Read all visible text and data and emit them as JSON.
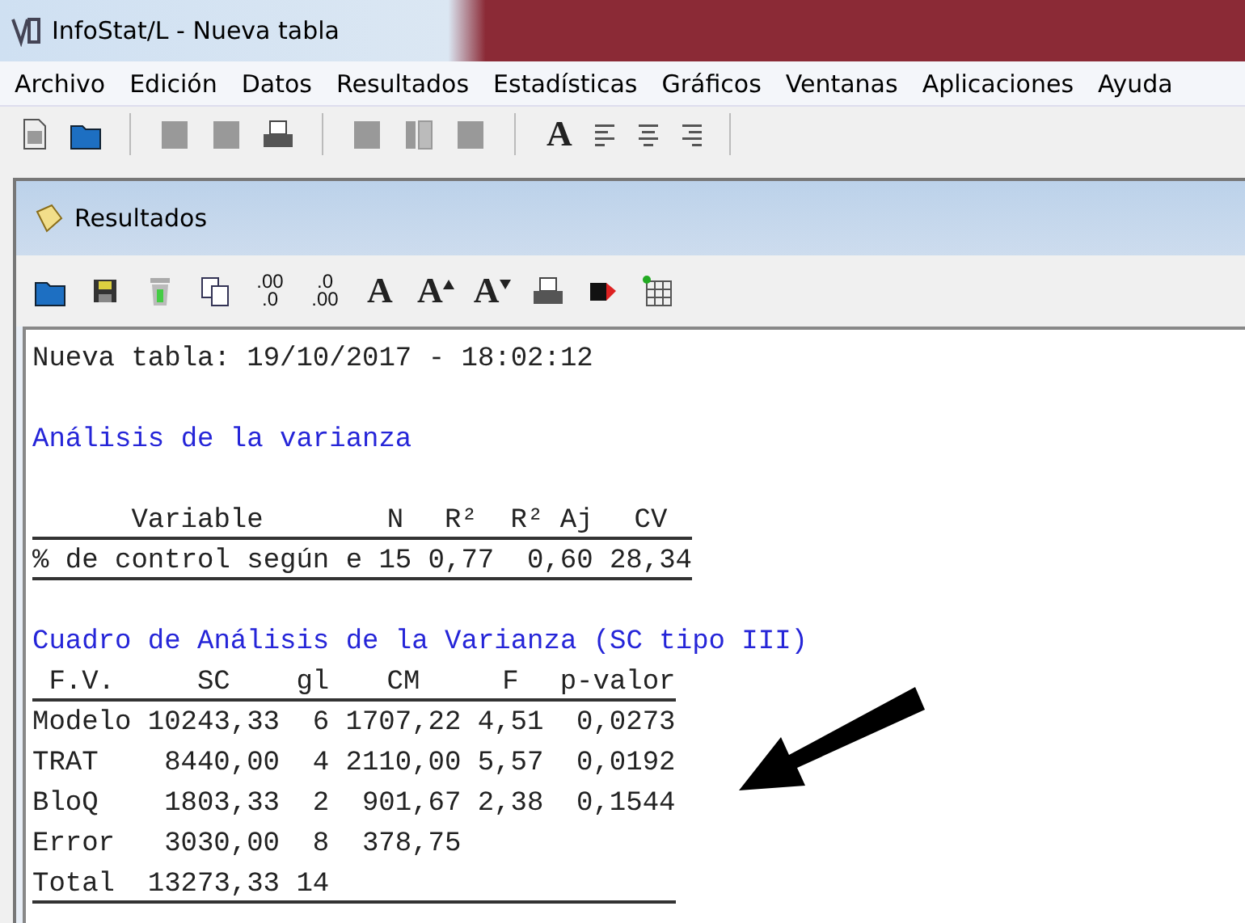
{
  "window": {
    "title": "InfoStat/L - Nueva tabla"
  },
  "menu": [
    "Archivo",
    "Edición",
    "Datos",
    "Resultados",
    "Estadísticas",
    "Gráficos",
    "Ventanas",
    "Aplicaciones",
    "Ayuda"
  ],
  "toolbar": [
    {
      "kind": "new"
    },
    {
      "kind": "open"
    },
    {
      "kind": "sep"
    },
    {
      "kind": "block"
    },
    {
      "kind": "block"
    },
    {
      "kind": "print"
    },
    {
      "kind": "sep"
    },
    {
      "kind": "block"
    },
    {
      "kind": "columns"
    },
    {
      "kind": "block"
    },
    {
      "kind": "sep"
    },
    {
      "kind": "letter",
      "text": "A"
    },
    {
      "kind": "align-left"
    },
    {
      "kind": "align-center"
    },
    {
      "kind": "align-right"
    },
    {
      "kind": "sep"
    }
  ],
  "results": {
    "title": "Resultados",
    "toolbar": [
      {
        "kind": "open"
      },
      {
        "kind": "save"
      },
      {
        "kind": "trash"
      },
      {
        "kind": "copy"
      },
      {
        "kind": "digits",
        "top": ".00",
        "bottom": ".0"
      },
      {
        "kind": "digits",
        "top": ".0",
        "bottom": ".00"
      },
      {
        "kind": "letter",
        "text": "A"
      },
      {
        "kind": "grow-font",
        "text": "A"
      },
      {
        "kind": "shrink-font",
        "text": "A"
      },
      {
        "kind": "print"
      },
      {
        "kind": "marker"
      },
      {
        "kind": "grid"
      }
    ],
    "timestamp": "Nueva tabla: 19/10/2017 - 18:02:12",
    "heading": "Análisis de la varianza",
    "summary": {
      "columns": [
        "Variable",
        "N",
        "R²",
        "R² Aj",
        "CV"
      ],
      "rows": [
        [
          "% de control según e",
          "15",
          "0,77",
          "0,60",
          "28,34"
        ]
      ]
    },
    "anova_heading": "Cuadro de Análisis de la Varianza (SC tipo III)",
    "anova": {
      "columns": [
        "F.V.",
        "SC",
        "gl",
        "CM",
        "F",
        "p-valor"
      ],
      "rows": [
        [
          "Modelo",
          "10243,33",
          "6",
          "1707,22",
          "4,51",
          "0,0273"
        ],
        [
          "TRAT",
          "8440,00",
          "4",
          "2110,00",
          "5,57",
          "0,0192"
        ],
        [
          "BloQ",
          "1803,33",
          "2",
          "901,67",
          "2,38",
          "0,1544"
        ],
        [
          "Error",
          "3030,00",
          "8",
          "378,75",
          "",
          ""
        ],
        [
          "Total",
          "13273,33",
          "14",
          "",
          "",
          ""
        ]
      ]
    }
  }
}
